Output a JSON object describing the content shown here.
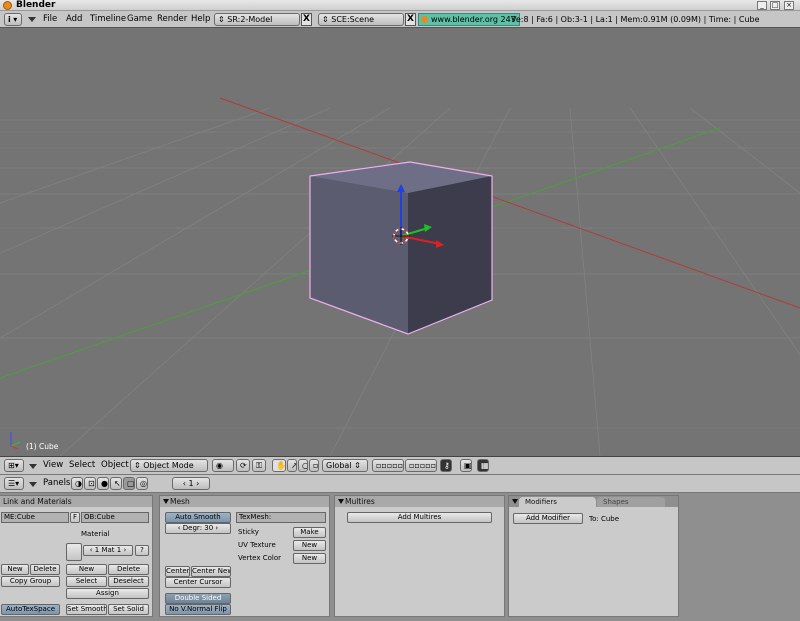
{
  "window": {
    "title": "Blender"
  },
  "info_header": {
    "menus": [
      "File",
      "Add",
      "Timeline",
      "Game",
      "Render",
      "Help"
    ],
    "screen": "SR:2-Model",
    "scene": "SCE:Scene",
    "url": "www.blender.org 247",
    "stats": "Ve:8 | Fa:6 | Ob:3-1 | La:1  | Mem:0.91M (0.09M)  | Time: | Cube"
  },
  "viewport": {
    "object_label": "(1) Cube",
    "colors": {
      "background": "#747474",
      "grid": "#828282",
      "x_axis": "#b23a3a",
      "y_axis": "#4aa03a",
      "cube_top": "#6e6e86",
      "cube_front": "#5c5c70",
      "cube_side": "#3c3c4c",
      "selection": "#f0b0f0"
    }
  },
  "view3d_header": {
    "menus": [
      "View",
      "Select",
      "Object"
    ],
    "mode": "Object Mode",
    "orientation": "Global"
  },
  "buttons_header": {
    "panels_label": "Panels",
    "frame": "1"
  },
  "link_materials": {
    "title": "Link and Materials",
    "mesh_field": "ME:Cube",
    "f_label": "F",
    "object_field": "OB:Cube",
    "material_label": "Material",
    "mat_counter": "1 Mat 1",
    "question": "?",
    "new_left": "New",
    "delete_left": "Delete",
    "copy_group": "Copy Group",
    "new_right": "New",
    "delete_right": "Delete",
    "select": "Select",
    "deselect": "Deselect",
    "assign": "Assign",
    "autotexspace": "AutoTexSpace",
    "set_smooth": "Set Smooth",
    "set_solid": "Set Solid"
  },
  "mesh": {
    "title": "Mesh",
    "auto_smooth": "Auto Smooth",
    "degr": "Degr: 30",
    "texmesh": "TexMesh:",
    "sticky": "Sticky",
    "make": "Make",
    "uv_texture": "UV Texture",
    "new_uv": "New",
    "vertex_color": "Vertex Color",
    "new_vc": "New",
    "center": "Center",
    "center_new": "Center New",
    "center_cursor": "Center Cursor",
    "double_sided": "Double Sided",
    "no_vnormal_flip": "No V.Normal Flip"
  },
  "multires": {
    "title": "Multires",
    "add_multires": "Add Multires"
  },
  "modifiers": {
    "tab_modifiers": "Modifiers",
    "tab_shapes": "Shapes",
    "add_modifier": "Add Modifier",
    "to": "To: Cube"
  }
}
